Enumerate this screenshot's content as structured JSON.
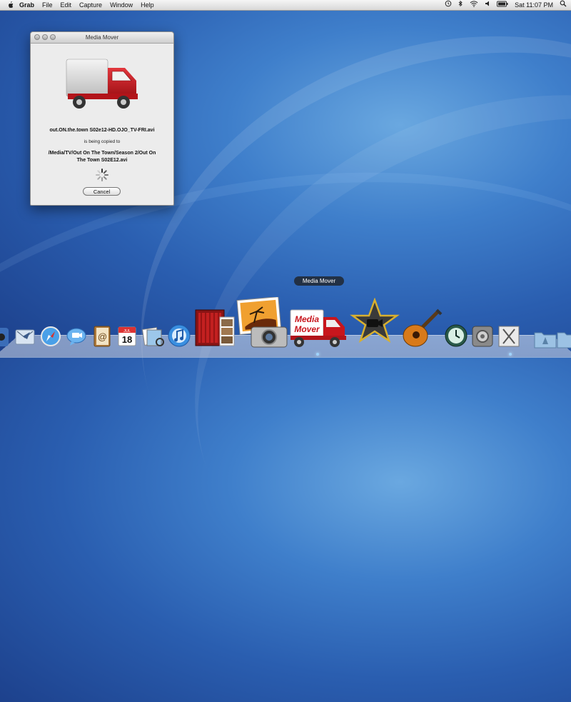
{
  "menubar": {
    "app_name": "Grab",
    "items": [
      "File",
      "Edit",
      "Capture",
      "Window",
      "Help"
    ],
    "clock": "Sat 11:07 PM"
  },
  "window": {
    "title": "Media Mover",
    "file_name": "out.ON.the.town S02e12-HD.OJO_TV-FRI.avi",
    "copy_text": "is being copied to",
    "destination_line1": "/Media/TV/Out On The Town/Season 2/Out On",
    "destination_line2": "The Town S02E12.avi",
    "cancel_label": "Cancel"
  },
  "truck_logo": {
    "line1": "Media",
    "line2": "Mover"
  },
  "dock": {
    "tooltip": "Media Mover",
    "calendar_month": "JUL",
    "calendar_day": "18"
  },
  "colors": {
    "truck_red": "#c8161d",
    "desktop_blue": "#2a5eb0"
  }
}
